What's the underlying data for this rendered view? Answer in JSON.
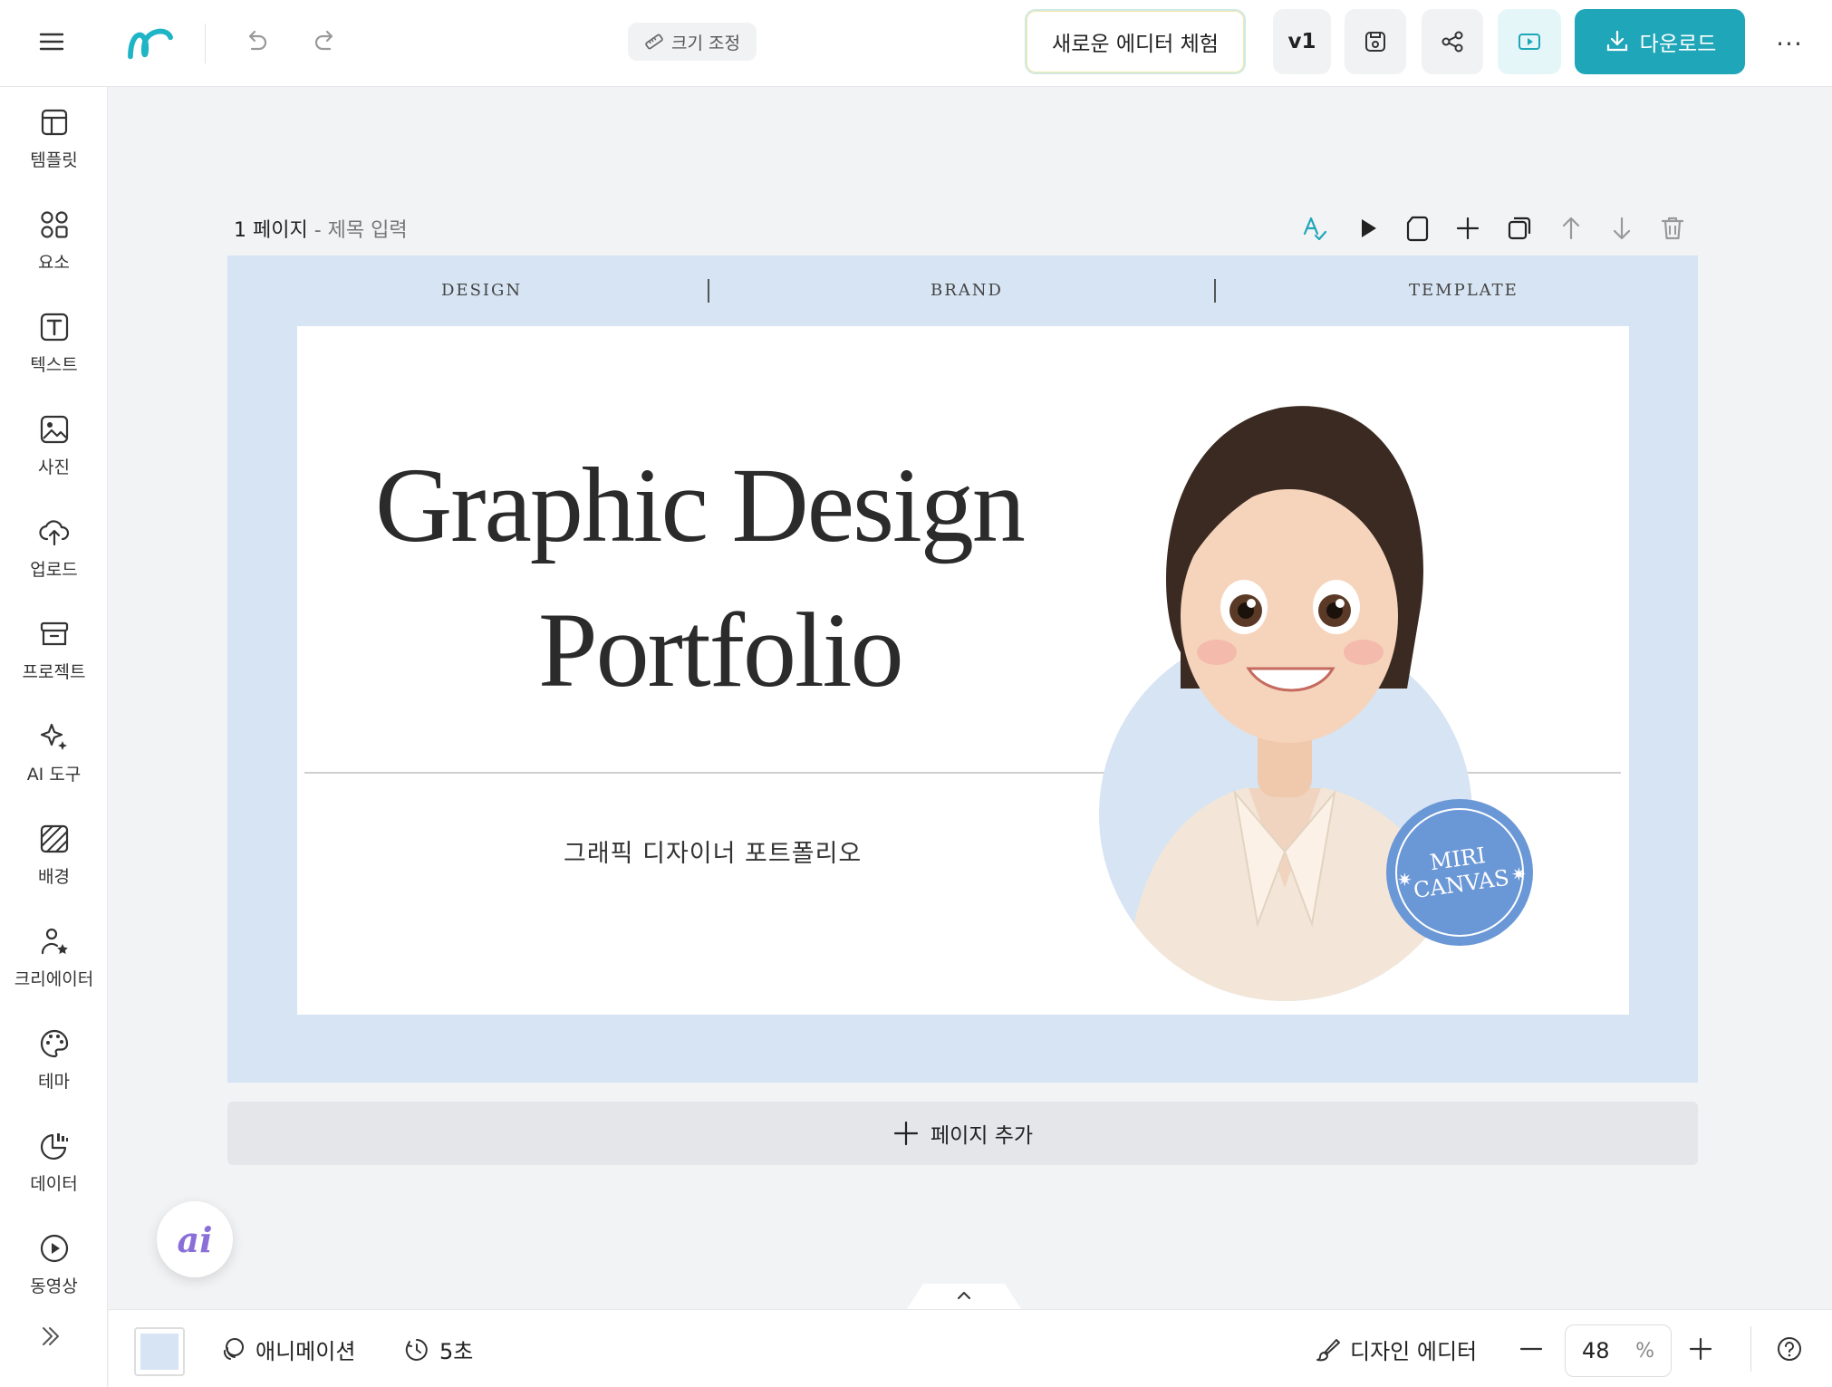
{
  "topbar": {
    "resize_label": "크기 조정",
    "try_editor_label": "새로운 에디터 체험",
    "version_label": "v1",
    "download_label": "다운로드",
    "more_label": "···"
  },
  "sidebar": {
    "items": [
      {
        "label": "템플릿",
        "icon": "template-icon"
      },
      {
        "label": "요소",
        "icon": "elements-icon"
      },
      {
        "label": "텍스트",
        "icon": "text-icon"
      },
      {
        "label": "사진",
        "icon": "photo-icon"
      },
      {
        "label": "업로드",
        "icon": "upload-icon"
      },
      {
        "label": "프로젝트",
        "icon": "project-icon"
      },
      {
        "label": "AI 도구",
        "icon": "ai-tools-icon"
      },
      {
        "label": "배경",
        "icon": "background-icon"
      },
      {
        "label": "크리에이터",
        "icon": "creator-icon"
      },
      {
        "label": "테마",
        "icon": "theme-icon"
      },
      {
        "label": "데이터",
        "icon": "data-icon"
      },
      {
        "label": "동영상",
        "icon": "video-icon"
      }
    ]
  },
  "page": {
    "number_label": "1 페이지",
    "separator": " - ",
    "title_placeholder": "제목 입력",
    "add_page_label": "페이지 추가"
  },
  "design": {
    "top_words": [
      "DESIGN",
      "BRAND",
      "TEMPLATE"
    ],
    "title_line1": "Graphic Design",
    "title_line2": "Portfolio",
    "subtitle": "그래픽 디자이너 포트폴리오",
    "badge_line1": "MIRI",
    "badge_line2": "CANVAS",
    "colors": {
      "background": "#d6e4f3",
      "badge": "#6a97d6",
      "accent": "#1fa6b8"
    }
  },
  "ai_fab_label": "ai",
  "bottombar": {
    "animation_label": "애니메이션",
    "duration_label": "5초",
    "design_editor_label": "디자인 에디터",
    "zoom_value": "48",
    "zoom_unit": "%"
  }
}
